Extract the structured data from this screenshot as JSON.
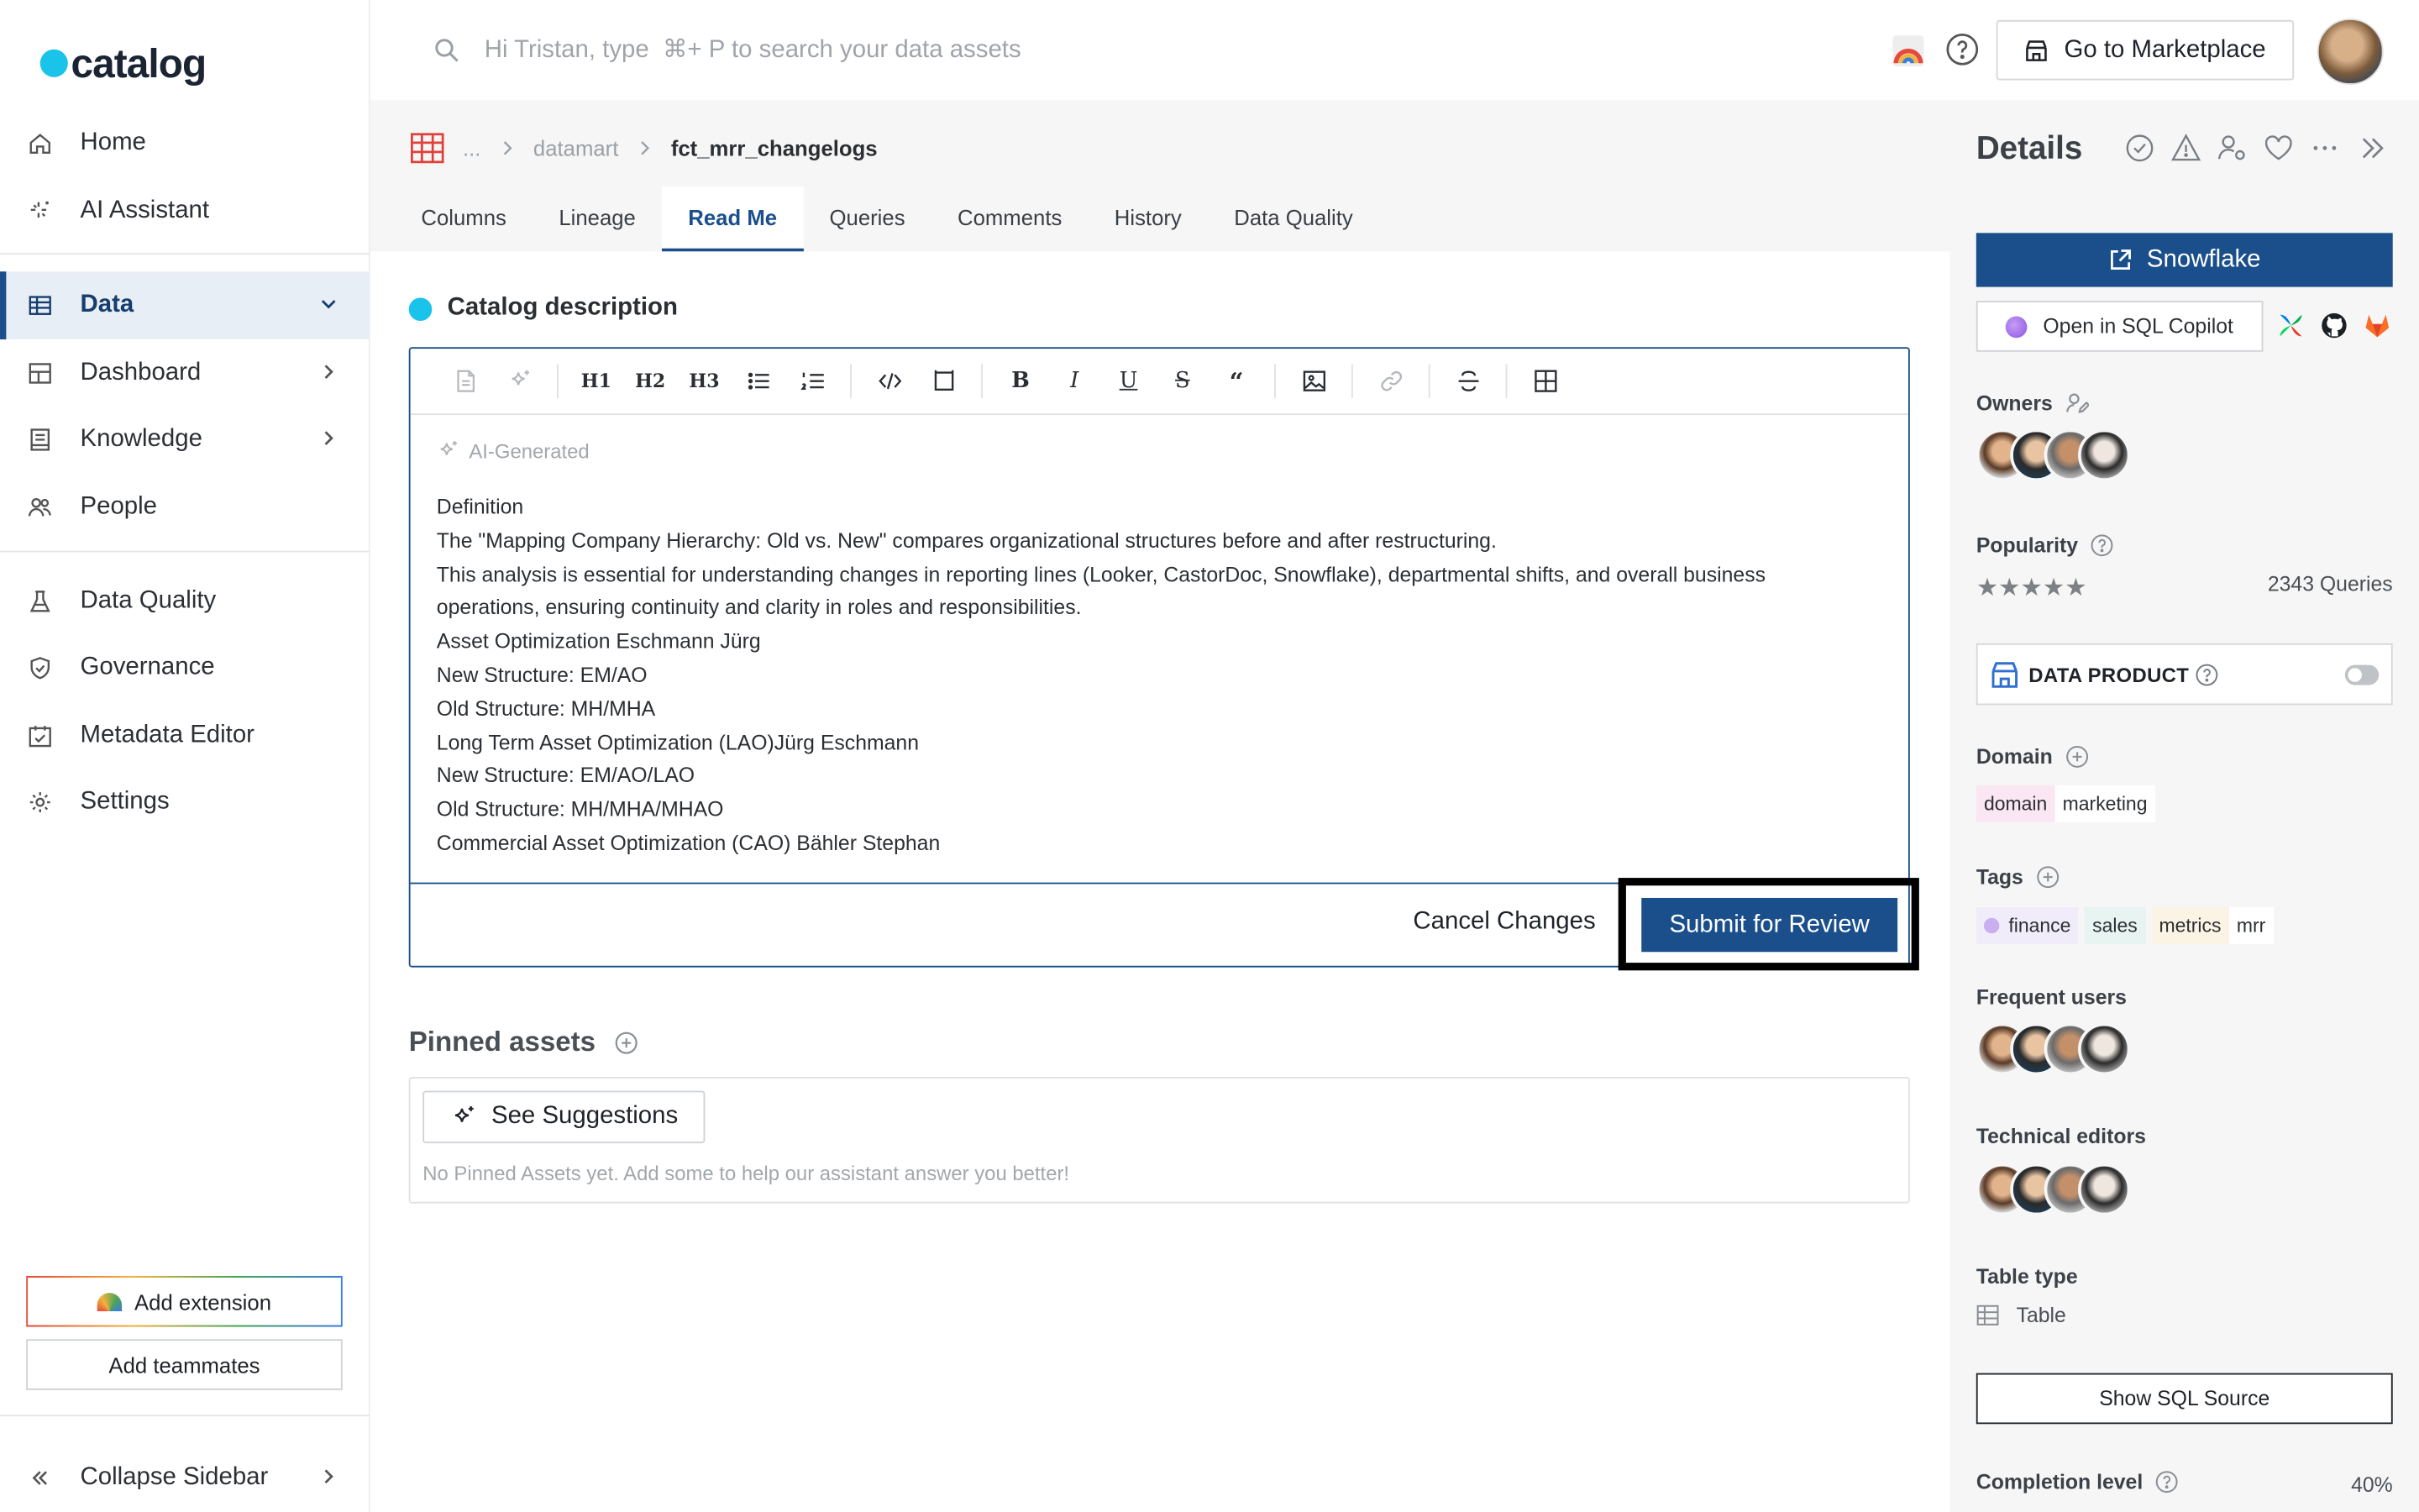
{
  "app": {
    "logo_text": "catalog"
  },
  "sidebar": {
    "items": [
      {
        "label": "Home",
        "icon": "home-icon"
      },
      {
        "label": "AI Assistant",
        "icon": "sparkle-icon"
      },
      {
        "label": "Data",
        "icon": "table-icon",
        "active": true
      },
      {
        "label": "Dashboard",
        "icon": "dashboard-icon"
      },
      {
        "label": "Knowledge",
        "icon": "book-icon"
      },
      {
        "label": "People",
        "icon": "people-icon"
      },
      {
        "label": "Data Quality",
        "icon": "flask-icon"
      },
      {
        "label": "Governance",
        "icon": "shield-icon"
      },
      {
        "label": "Metadata Editor",
        "icon": "editor-icon"
      },
      {
        "label": "Settings",
        "icon": "gear-icon"
      }
    ],
    "add_extension": "Add extension",
    "add_teammates": "Add teammates",
    "collapse": "Collapse Sidebar"
  },
  "topbar": {
    "search_placeholder": "Hi Tristan, type  ⌘+ P to search your data assets",
    "marketplace": "Go to Marketplace"
  },
  "breadcrumb": {
    "ellipsis": "...",
    "parent": "datamart",
    "current": "fct_mrr_changelogs"
  },
  "tabs": [
    "Columns",
    "Lineage",
    "Read Me",
    "Queries",
    "Comments",
    "History",
    "Data Quality"
  ],
  "active_tab": "Read Me",
  "description": {
    "title": "Catalog description",
    "ai_generated": "AI-Generated",
    "lines": [
      "Definition",
      "The \"Mapping Company Hierarchy: Old vs. New\" compares organizational structures before and after restructuring.",
      "This analysis is essential for understanding changes in reporting lines (Looker, CastorDoc, Snowflake), departmental shifts, and overall business operations, ensuring continuity and clarity in roles and responsibilities.",
      "Asset Optimization  Eschmann Jürg",
      "New Structure: EM/AO",
      "Old Structure: MH/MHA",
      "Long Term Asset Optimization (LAO)Jürg Eschmann",
      "New Structure: EM/AO/LAO",
      "Old Structure: MH/MHA/MHAO",
      "Commercial Asset Optimization (CAO) Bähler Stephan"
    ],
    "cancel": "Cancel Changes",
    "submit": "Submit for Review"
  },
  "pinned": {
    "title": "Pinned assets",
    "suggestions": "See Suggestions",
    "empty": "No Pinned Assets yet. Add some to help our assistant answer you better!"
  },
  "details": {
    "title": "Details",
    "snowflake": "Snowflake",
    "sql_copilot": "Open in SQL Copilot",
    "owners": "Owners",
    "popularity": "Popularity",
    "stars": "★★★★★",
    "queries": "2343 Queries",
    "data_product": "DATA PRODUCT",
    "domain_label": "Domain",
    "domain_key": "domain",
    "domain_value": "marketing",
    "tags_label": "Tags",
    "tags": [
      "finance",
      "sales",
      "metrics",
      "mrr"
    ],
    "frequent_users": "Frequent users",
    "technical_editors": "Technical editors",
    "table_type_label": "Table type",
    "table_type": "Table",
    "show_sql": "Show SQL Source",
    "completion_label": "Completion level",
    "completion_value": "40%"
  },
  "colors": {
    "accent": "#1a4f8b",
    "brand": "#19c3ea",
    "table_icon": "#e0413a"
  }
}
